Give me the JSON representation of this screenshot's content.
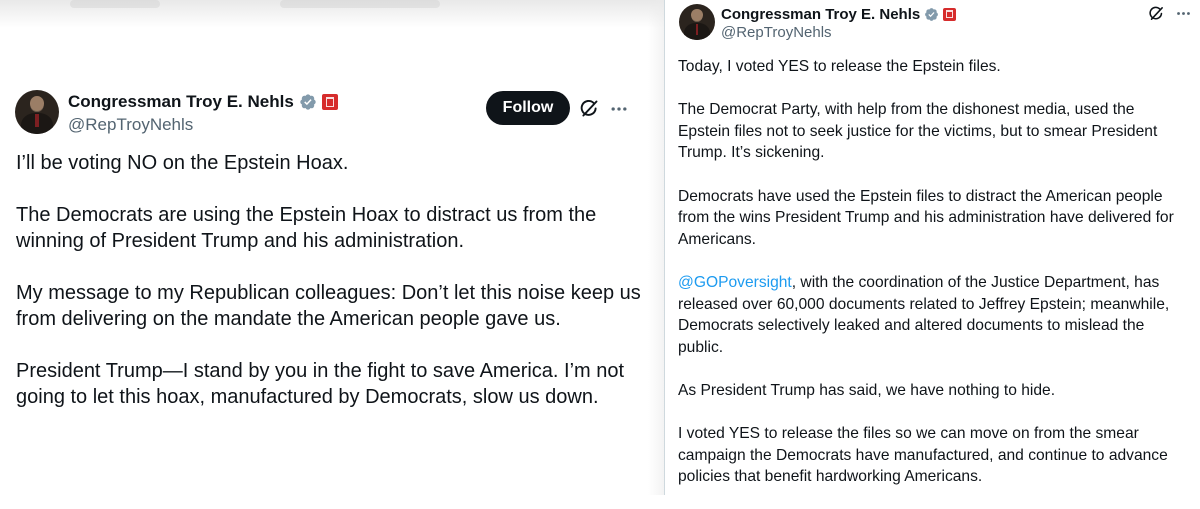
{
  "left_tweet": {
    "author_name": "Congressman Troy E. Nehls",
    "handle": "@RepTroyNehls",
    "follow_label": "Follow",
    "paragraphs": [
      "I’ll be voting NO on the Epstein Hoax.",
      "The Democrats are using the Epstein Hoax to distract us from the winning of President Trump and his administration.",
      "My message to my Republican colleagues: Don’t let this noise keep us from delivering on the mandate the American people gave us.",
      "President Trump—I stand by you in the fight to save America. I’m not going to let this hoax, manufactured by Democrats, slow us down."
    ]
  },
  "right_tweet": {
    "author_name": "Congressman Troy E. Nehls",
    "handle": "@RepTroyNehls",
    "paragraphs": [
      "Today, I voted YES to release the Epstein files.",
      "The Democrat Party, with help from the dishonest media, used the Epstein files not to seek justice for the victims, but to smear President Trump. It’s sickening.",
      "Democrats have used the Epstein files to distract the American people from the wins President Trump and his administration have delivered for Americans."
    ],
    "mention": "@GOPoversight",
    "mention_paragraph_rest": ", with the coordination of the Justice Department, has released over 60,000 documents related to Jeffrey Epstein; meanwhile, Democrats selectively leaked and altered documents to mislead the public.",
    "paragraphs_after": [
      "As President Trump has said, we have nothing to hide.",
      "I voted YES to release the files so we can move on from the smear campaign the Democrats have manufactured, and continue to advance policies that benefit hardworking Americans."
    ]
  },
  "icons": {
    "verified": "verified-badge-icon",
    "affiliation": "government-affiliation-icon",
    "grok": "grok-icon",
    "more": "more-options-icon"
  },
  "colors": {
    "text": "#0f1419",
    "secondary_text": "#536471",
    "link": "#1d9bf0",
    "verified_badge": "#829aab",
    "follow_button_bg": "#0f1419",
    "affiliation_badge": "#d62c2c"
  }
}
